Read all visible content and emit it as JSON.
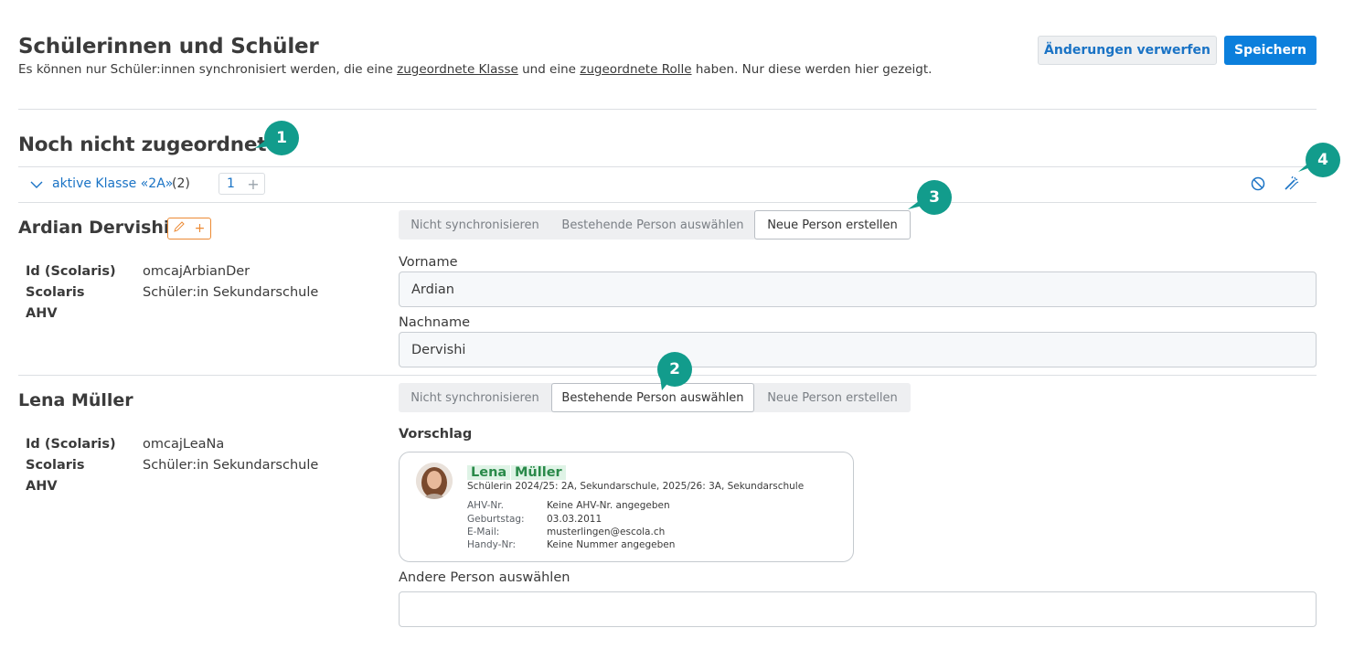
{
  "header": {
    "title": "Schülerinnen und Schüler",
    "subtitle_pre": "Es können nur Schüler:innen synchronisiert werden, die eine ",
    "subtitle_link1": "zugeordnete Klasse",
    "subtitle_mid": " und eine ",
    "subtitle_link2": "zugeordnete Rolle",
    "subtitle_post": " haben. Nur diese werden hier gezeigt.",
    "discard_label": "Änderungen verwerfen",
    "save_label": "Speichern"
  },
  "section": {
    "title": "Noch nicht zugeordnet"
  },
  "group": {
    "label": "aktive Klasse «2A»",
    "count": "(2)",
    "counter_value": "1",
    "block_icon": "block-icon",
    "wand_icon": "magic-wand-icon"
  },
  "markers": [
    "1",
    "2",
    "3",
    "4"
  ],
  "sync_options": [
    "Nicht synchronisieren",
    "Bestehende Person auswählen",
    "Neue Person erstellen"
  ],
  "persons": [
    {
      "name": "Ardian Dervishi",
      "meta": [
        {
          "label": "Id (Scolaris)",
          "value": "omcajArbianDer"
        },
        {
          "label": "Scolaris",
          "value": "Schüler:in Sekundarschule"
        },
        {
          "label": "AHV",
          "value": ""
        }
      ],
      "selected_option": "Neue Person erstellen",
      "fields": [
        {
          "label": "Vorname",
          "value": "Ardian"
        },
        {
          "label": "Nachname",
          "value": "Dervishi"
        }
      ]
    },
    {
      "name": "Lena Müller",
      "meta": [
        {
          "label": "Id (Scolaris)",
          "value": "omcajLeaNa"
        },
        {
          "label": "Scolaris",
          "value": "Schüler:in Sekundarschule"
        },
        {
          "label": "AHV",
          "value": ""
        }
      ],
      "selected_option": "Bestehende Person auswählen",
      "suggestion_label": "Vorschlag",
      "suggestion": {
        "first_name": "Lena",
        "last_name": "Müller",
        "subtitle": "Schülerin 2024/25: 2A, Sekundarschule, 2025/26: 3A, Sekundarschule",
        "details": [
          {
            "key": "AHV-Nr.",
            "value": "Keine AHV-Nr. angegeben"
          },
          {
            "key": "Geburtstag:",
            "value": "03.03.2011"
          },
          {
            "key": "E-Mail:",
            "value": "musterlingen@escola.ch"
          },
          {
            "key": "Handy-Nr:",
            "value": "Keine Nummer angegeben"
          }
        ]
      },
      "other_label": "Andere Person auswählen",
      "other_value": ""
    }
  ],
  "colors": {
    "primary": "#0b7fdc",
    "link": "#1a73c5",
    "marker": "#129c8c",
    "edit": "#ec8a34",
    "highlight": "#dff3e6"
  }
}
